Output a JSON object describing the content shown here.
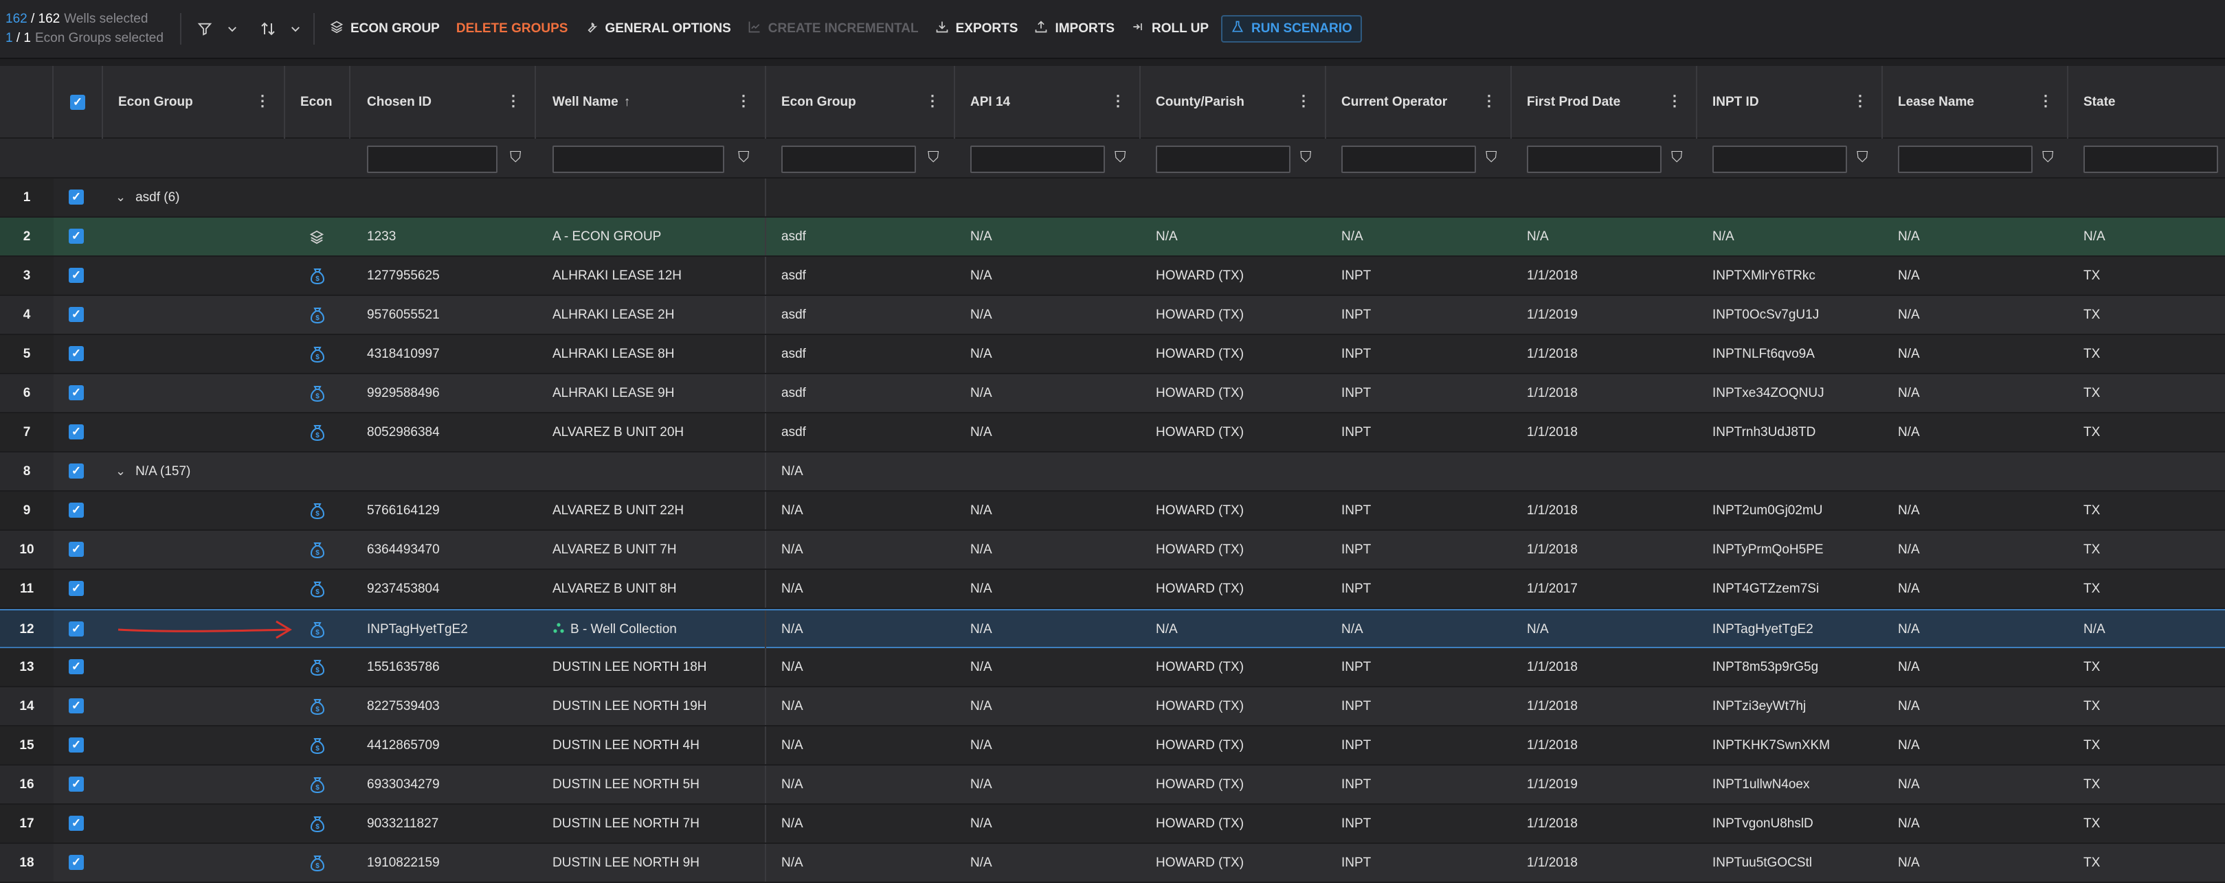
{
  "selection": {
    "wells_selected": "162",
    "wells_total": "162",
    "wells_label": "Wells selected",
    "groups_selected": "1",
    "groups_total": "1",
    "groups_label": "Econ Groups selected"
  },
  "toolbar": {
    "econ_group": "ECON GROUP",
    "delete_groups": "DELETE GROUPS",
    "general_options": "GENERAL OPTIONS",
    "create_incremental": "CREATE INCREMENTAL",
    "exports": "EXPORTS",
    "imports": "IMPORTS",
    "roll_up": "ROLL UP",
    "run_scenario": "RUN SCENARIO"
  },
  "columns": {
    "econ_group_tree": "Econ Group",
    "econ": "Econ",
    "chosen_id": "Chosen ID",
    "well_name": "Well Name",
    "econ_group": "Econ Group",
    "api14": "API 14",
    "county": "County/Parish",
    "operator": "Current Operator",
    "first_prod": "First Prod Date",
    "inpt_id": "INPT ID",
    "lease": "Lease Name",
    "state": "State"
  },
  "rows": [
    {
      "num": "1",
      "kind": "group",
      "label": "asdf (6)"
    },
    {
      "num": "2",
      "kind": "econgroup",
      "chosen_id": "1233",
      "well_name": "A - ECON GROUP",
      "econ_group": "asdf",
      "api14": "N/A",
      "county": "N/A",
      "operator": "N/A",
      "first_prod": "N/A",
      "inpt_id": "N/A",
      "lease": "N/A",
      "state": "N/A"
    },
    {
      "num": "3",
      "kind": "well",
      "chosen_id": "1277955625",
      "well_name": "ALHRAKI LEASE 12H",
      "econ_group": "asdf",
      "api14": "N/A",
      "county": "HOWARD (TX)",
      "operator": "INPT",
      "first_prod": "1/1/2018",
      "inpt_id": "INPTXMlrY6TRkc",
      "lease": "N/A",
      "state": "TX"
    },
    {
      "num": "4",
      "kind": "well",
      "chosen_id": "9576055521",
      "well_name": "ALHRAKI LEASE 2H",
      "econ_group": "asdf",
      "api14": "N/A",
      "county": "HOWARD (TX)",
      "operator": "INPT",
      "first_prod": "1/1/2019",
      "inpt_id": "INPT0OcSv7gU1J",
      "lease": "N/A",
      "state": "TX"
    },
    {
      "num": "5",
      "kind": "well",
      "chosen_id": "4318410997",
      "well_name": "ALHRAKI LEASE 8H",
      "econ_group": "asdf",
      "api14": "N/A",
      "county": "HOWARD (TX)",
      "operator": "INPT",
      "first_prod": "1/1/2018",
      "inpt_id": "INPTNLFt6qvo9A",
      "lease": "N/A",
      "state": "TX"
    },
    {
      "num": "6",
      "kind": "well",
      "chosen_id": "9929588496",
      "well_name": "ALHRAKI LEASE 9H",
      "econ_group": "asdf",
      "api14": "N/A",
      "county": "HOWARD (TX)",
      "operator": "INPT",
      "first_prod": "1/1/2018",
      "inpt_id": "INPTxe34ZOQNUJ",
      "lease": "N/A",
      "state": "TX"
    },
    {
      "num": "7",
      "kind": "well",
      "chosen_id": "8052986384",
      "well_name": "ALVAREZ B UNIT 20H",
      "econ_group": "asdf",
      "api14": "N/A",
      "county": "HOWARD (TX)",
      "operator": "INPT",
      "first_prod": "1/1/2018",
      "inpt_id": "INPTrnh3UdJ8TD",
      "lease": "N/A",
      "state": "TX"
    },
    {
      "num": "8",
      "kind": "group",
      "label": "N/A (157)",
      "econ_group": "N/A"
    },
    {
      "num": "9",
      "kind": "well",
      "chosen_id": "5766164129",
      "well_name": "ALVAREZ B UNIT 22H",
      "econ_group": "N/A",
      "api14": "N/A",
      "county": "HOWARD (TX)",
      "operator": "INPT",
      "first_prod": "1/1/2018",
      "inpt_id": "INPT2um0Gj02mU",
      "lease": "N/A",
      "state": "TX"
    },
    {
      "num": "10",
      "kind": "well",
      "chosen_id": "6364493470",
      "well_name": "ALVAREZ B UNIT 7H",
      "econ_group": "N/A",
      "api14": "N/A",
      "county": "HOWARD (TX)",
      "operator": "INPT",
      "first_prod": "1/1/2018",
      "inpt_id": "INPTyPrmQoH5PE",
      "lease": "N/A",
      "state": "TX"
    },
    {
      "num": "11",
      "kind": "well",
      "chosen_id": "9237453804",
      "well_name": "ALVAREZ B UNIT 8H",
      "econ_group": "N/A",
      "api14": "N/A",
      "county": "HOWARD (TX)",
      "operator": "INPT",
      "first_prod": "1/1/2017",
      "inpt_id": "INPT4GTZzem7Si",
      "lease": "N/A",
      "state": "TX"
    },
    {
      "num": "12",
      "kind": "collection",
      "chosen_id": "INPTagHyetTgE2",
      "well_name": "B - Well Collection",
      "econ_group": "N/A",
      "api14": "N/A",
      "county": "N/A",
      "operator": "N/A",
      "first_prod": "N/A",
      "inpt_id": "INPTagHyetTgE2",
      "lease": "N/A",
      "state": "N/A"
    },
    {
      "num": "13",
      "kind": "well",
      "chosen_id": "1551635786",
      "well_name": "DUSTIN LEE NORTH 18H",
      "econ_group": "N/A",
      "api14": "N/A",
      "county": "HOWARD (TX)",
      "operator": "INPT",
      "first_prod": "1/1/2018",
      "inpt_id": "INPT8m53p9rG5g",
      "lease": "N/A",
      "state": "TX"
    },
    {
      "num": "14",
      "kind": "well",
      "chosen_id": "8227539403",
      "well_name": "DUSTIN LEE NORTH 19H",
      "econ_group": "N/A",
      "api14": "N/A",
      "county": "HOWARD (TX)",
      "operator": "INPT",
      "first_prod": "1/1/2018",
      "inpt_id": "INPTzi3eyWt7hj",
      "lease": "N/A",
      "state": "TX"
    },
    {
      "num": "15",
      "kind": "well",
      "chosen_id": "4412865709",
      "well_name": "DUSTIN LEE NORTH 4H",
      "econ_group": "N/A",
      "api14": "N/A",
      "county": "HOWARD (TX)",
      "operator": "INPT",
      "first_prod": "1/1/2018",
      "inpt_id": "INPTKHK7SwnXKM",
      "lease": "N/A",
      "state": "TX"
    },
    {
      "num": "16",
      "kind": "well",
      "chosen_id": "6933034279",
      "well_name": "DUSTIN LEE NORTH 5H",
      "econ_group": "N/A",
      "api14": "N/A",
      "county": "HOWARD (TX)",
      "operator": "INPT",
      "first_prod": "1/1/2019",
      "inpt_id": "INPT1ullwN4oex",
      "lease": "N/A",
      "state": "TX"
    },
    {
      "num": "17",
      "kind": "well",
      "chosen_id": "9033211827",
      "well_name": "DUSTIN LEE NORTH 7H",
      "econ_group": "N/A",
      "api14": "N/A",
      "county": "HOWARD (TX)",
      "operator": "INPT",
      "first_prod": "1/1/2018",
      "inpt_id": "INPTvgonU8hslD",
      "lease": "N/A",
      "state": "TX"
    },
    {
      "num": "18",
      "kind": "well",
      "chosen_id": "1910822159",
      "well_name": "DUSTIN LEE NORTH 9H",
      "econ_group": "N/A",
      "api14": "N/A",
      "county": "HOWARD (TX)",
      "operator": "INPT",
      "first_prod": "1/1/2018",
      "inpt_id": "INPTuu5tGOCStl",
      "lease": "N/A",
      "state": "TX"
    }
  ],
  "icons": {
    "filter": "filter-icon",
    "sort": "sort-icon",
    "econ": "money-bag-icon",
    "econ_group": "layers-icon",
    "collection": "well-collection-icon"
  },
  "colors": {
    "accent": "#2f8de4",
    "danger": "#f0703e",
    "group_row": "#2b4a3c",
    "selected_row": "#26394d"
  }
}
